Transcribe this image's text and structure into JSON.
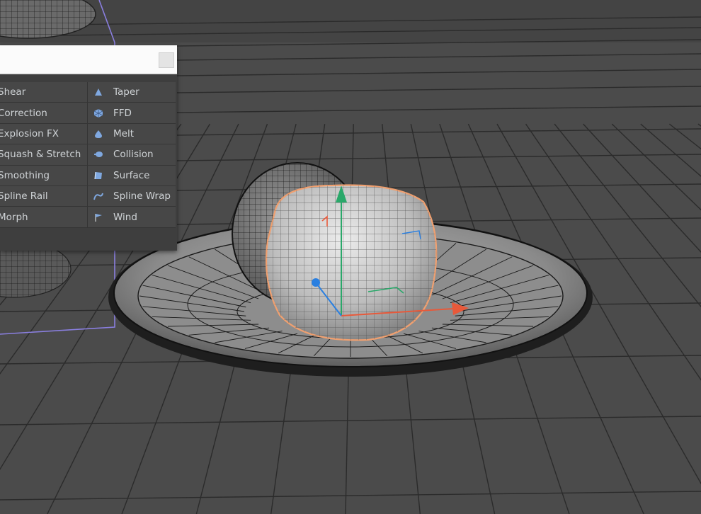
{
  "deformer_menu": {
    "search_value": "",
    "left_items": [
      {
        "label": "Shear"
      },
      {
        "label": "Correction"
      },
      {
        "label": "Explosion FX"
      },
      {
        "label": "Squash & Stretch"
      },
      {
        "label": "Smoothing"
      },
      {
        "label": "Spline Rail"
      },
      {
        "label": "Morph"
      }
    ],
    "right_items": [
      {
        "label": "Taper",
        "icon": "taper-icon"
      },
      {
        "label": "FFD",
        "icon": "ffd-icon"
      },
      {
        "label": "Melt",
        "icon": "melt-icon"
      },
      {
        "label": "Collision",
        "icon": "collision-icon"
      },
      {
        "label": "Surface",
        "icon": "surface-icon"
      },
      {
        "label": "Spline Wrap",
        "icon": "spline-wrap-icon"
      },
      {
        "label": "Wind",
        "icon": "wind-icon"
      }
    ]
  },
  "colors": {
    "viewport_bg": "#4b4b4b",
    "grid_line": "#2a2a2a",
    "selection_outline": "#f0a070",
    "bounding_box": "#8a7fe0",
    "axis_x": "#e8593a",
    "axis_y": "#2aa86a",
    "axis_z": "#2a7fe0",
    "icon_blue": "#7fa8e0"
  }
}
